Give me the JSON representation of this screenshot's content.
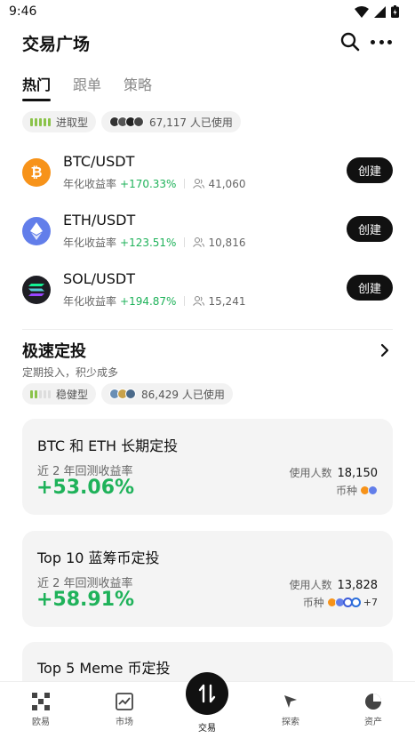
{
  "status": {
    "time": "9:46"
  },
  "header": {
    "title": "交易广场",
    "search_icon": "search-icon",
    "more_icon": "more-icon"
  },
  "tabs": [
    {
      "label": "热门",
      "active": true
    },
    {
      "label": "跟单",
      "active": false
    },
    {
      "label": "策略",
      "active": false
    }
  ],
  "grid_section": {
    "risk_label": "进取型",
    "users_text": "67,117 人已使用",
    "pairs": [
      {
        "pair": "BTC/USDT",
        "yield_label": "年化收益率",
        "yield": "+170.33%",
        "users": "41,060",
        "button": "创建",
        "color": "#f7931a",
        "icon": "bitcoin-icon"
      },
      {
        "pair": "ETH/USDT",
        "yield_label": "年化收益率",
        "yield": "+123.51%",
        "users": "10,816",
        "button": "创建",
        "color": "#627eea",
        "icon": "ethereum-icon"
      },
      {
        "pair": "SOL/USDT",
        "yield_label": "年化收益率",
        "yield": "+194.87%",
        "users": "15,241",
        "button": "创建",
        "color": "#1e1e24",
        "icon": "solana-icon"
      }
    ]
  },
  "dca_section": {
    "title": "极速定投",
    "subtitle": "定期投入，积少成多",
    "risk_label": "稳健型",
    "users_text": "86,429 人已使用",
    "cards": [
      {
        "title": "BTC 和 ETH 长期定投",
        "label": "近 2 年回测收益率",
        "value": "+53.06%",
        "users_label": "使用人数",
        "users": "18,150",
        "coins_label": "币种",
        "more": ""
      },
      {
        "title": "Top 10 蓝筹币定投",
        "label": "近 2 年回测收益率",
        "value": "+58.91%",
        "users_label": "使用人数",
        "users": "13,828",
        "coins_label": "币种",
        "more": "+7"
      },
      {
        "title": "Top 5 Meme 币定投"
      }
    ]
  },
  "bottom_nav": [
    {
      "label": "欧易",
      "icon": "okx-logo-icon"
    },
    {
      "label": "市场",
      "icon": "market-chart-icon"
    },
    {
      "label": "交易",
      "icon": "trade-swap-icon"
    },
    {
      "label": "探索",
      "icon": "explore-icon"
    },
    {
      "label": "资产",
      "icon": "assets-pie-icon"
    }
  ],
  "colors": {
    "gain": "#1fb25a",
    "button_bg": "#111111",
    "card_bg": "#f4f4f4"
  }
}
